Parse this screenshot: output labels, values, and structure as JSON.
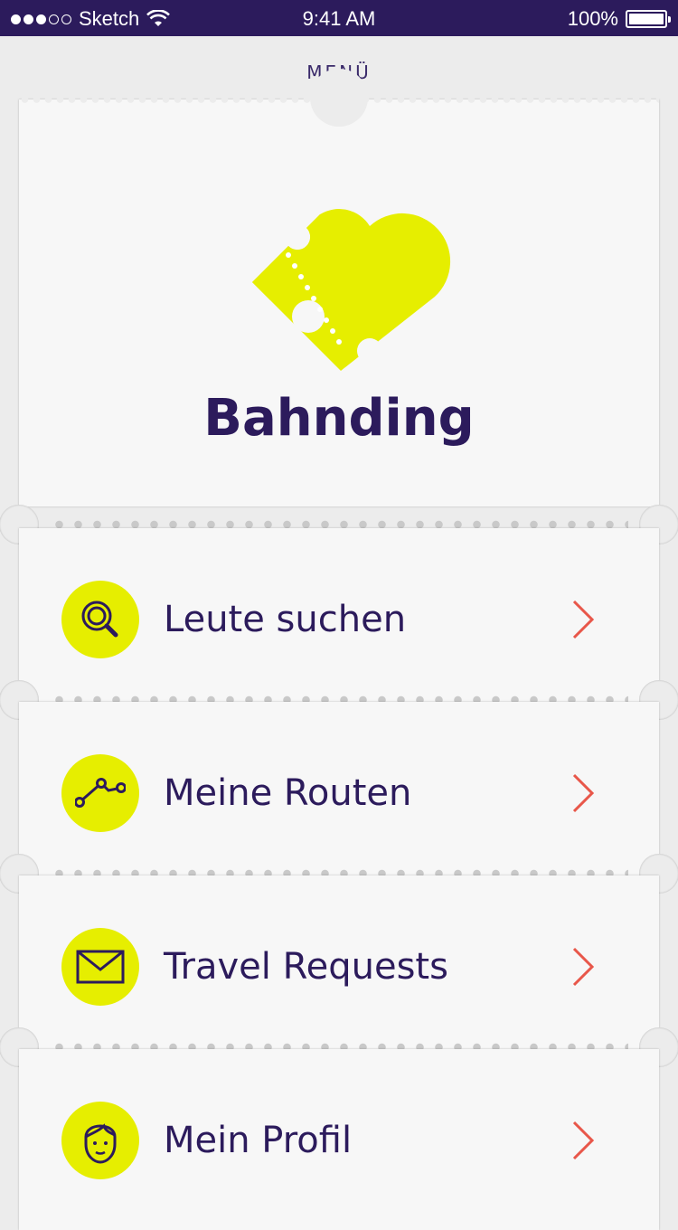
{
  "status_bar": {
    "carrier": "Sketch",
    "time": "9:41 AM",
    "battery": "100%"
  },
  "screen_title": "MENÜ",
  "app": {
    "name": "Bahnding"
  },
  "colors": {
    "brand_purple": "#2c1b5c",
    "accent_yellow": "#e6ee00",
    "chevron_red": "#e8574a"
  },
  "menu": [
    {
      "label": "Leute suchen",
      "icon": "search-icon"
    },
    {
      "label": "Meine Routen",
      "icon": "route-icon"
    },
    {
      "label": "Travel Requests",
      "icon": "mail-icon"
    },
    {
      "label": "Mein Profil",
      "icon": "profile-icon"
    }
  ]
}
